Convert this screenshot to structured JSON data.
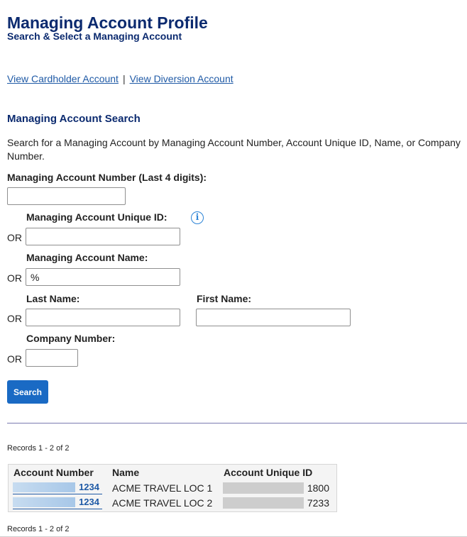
{
  "page": {
    "title": "Managing Account Profile",
    "subtitle": "Search & Select a Managing Account"
  },
  "nav": {
    "cardholder_link": "View Cardholder Account",
    "separator": "|",
    "diversion_link": "View Diversion Account"
  },
  "search": {
    "section_title": "Managing Account Search",
    "instructions": "Search for a Managing Account by Managing Account Number, Account Unique ID, Name, or Company Number.",
    "or_label": "OR",
    "account_number": {
      "label": "Managing Account Number (Last 4 digits):",
      "value": ""
    },
    "unique_id": {
      "label": "Managing Account Unique ID:",
      "value": "",
      "info_icon": "info-icon"
    },
    "account_name": {
      "label": "Managing Account Name:",
      "value": "%"
    },
    "last_name": {
      "label": "Last Name:",
      "value": ""
    },
    "first_name": {
      "label": "First Name:",
      "value": ""
    },
    "company_number": {
      "label": "Company Number:",
      "value": ""
    },
    "button_label": "Search"
  },
  "results": {
    "records_top": "Records 1 - 2 of 2",
    "records_bottom": "Records 1 - 2 of 2",
    "columns": [
      "Account Number",
      "Name",
      "Account Unique ID"
    ],
    "rows": [
      {
        "account_number": "1234",
        "name": "ACME TRAVEL LOC 1",
        "unique_id": "1800"
      },
      {
        "account_number": "1234",
        "name": "ACME TRAVEL LOC 2",
        "unique_id": "7233"
      }
    ]
  },
  "colors": {
    "heading": "#0b2a6f",
    "link": "#1f5aa6",
    "button": "#1a6ac4",
    "info_icon": "#2b83d6"
  }
}
